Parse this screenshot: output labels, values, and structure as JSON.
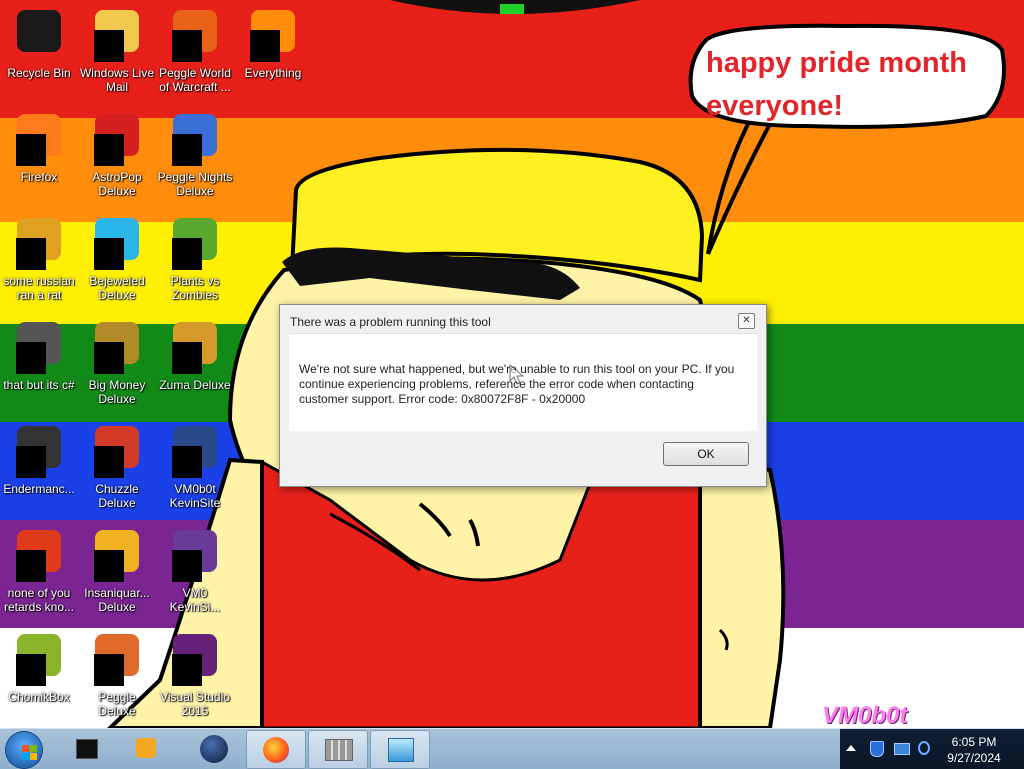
{
  "wallpaper": {
    "stripe_colors": [
      "#e8201a",
      "#ff8c0a",
      "#ffef05",
      "#118a18",
      "#1a40e8",
      "#7a2592"
    ],
    "speech_text": "happy pride month everyone!",
    "watermark": "VM0b0t"
  },
  "desktop": {
    "icons": [
      {
        "name": "icon-recycle-bin",
        "label": "Recycle Bin",
        "color": "#1a1a1a"
      },
      {
        "name": "icon-windows-live-mail",
        "label": "Windows Live Mail",
        "color": "#f2c94c"
      },
      {
        "name": "icon-peggle-world-of-warcraft",
        "label": "Peggle World of Warcraft ...",
        "color": "#e8621a"
      },
      {
        "name": "icon-everything",
        "label": "Everything",
        "color": "#ff8c0a"
      },
      {
        "name": "icon-firefox",
        "label": "Firefox",
        "color": "#ff7a1a"
      },
      {
        "name": "icon-astropop-deluxe",
        "label": "AstroPop Deluxe",
        "color": "#d62020"
      },
      {
        "name": "icon-peggle-nights-deluxe",
        "label": "Peggle Nights Deluxe",
        "color": "#3a6fd8"
      },
      {
        "name": "icon-some-russian-ran-a-rat",
        "label": "some russian ran a rat",
        "color": "#e0a020"
      },
      {
        "name": "icon-bejeweled-deluxe",
        "label": "Bejeweled Deluxe",
        "color": "#2ab5e8"
      },
      {
        "name": "icon-plants-vs-zombies",
        "label": "Plants vs Zombies",
        "color": "#5aa830"
      },
      {
        "name": "icon-that-but-its-csharp",
        "label": "that but its c#",
        "color": "#555555"
      },
      {
        "name": "icon-big-money-deluxe",
        "label": "Big Money Deluxe",
        "color": "#b38a2a"
      },
      {
        "name": "icon-zuma-deluxe",
        "label": "Zuma Deluxe",
        "color": "#d69a2a"
      },
      {
        "name": "icon-endermanch",
        "label": "Endermanc...",
        "color": "#333333"
      },
      {
        "name": "icon-chuzzle-deluxe",
        "label": "Chuzzle Deluxe",
        "color": "#d23a2a"
      },
      {
        "name": "icon-vm0b0t-kevinsite",
        "label": "VM0b0t KevinSite",
        "color": "#2a4a8a"
      },
      {
        "name": "icon-none-of-you-retards-kno",
        "label": "none of you retards kno...",
        "color": "#e03a1a"
      },
      {
        "name": "icon-insaniquarium-deluxe",
        "label": "Insaniquar... Deluxe",
        "color": "#f0b020"
      },
      {
        "name": "icon-vm0-kevinsite",
        "label": "VM0 KevinSi...",
        "color": "#6a3a9a"
      },
      {
        "name": "icon-chomikbox",
        "label": "ChomikBox",
        "color": "#8ab52a"
      },
      {
        "name": "icon-peggle-deluxe",
        "label": "Peggle Deluxe",
        "color": "#e06a2a"
      },
      {
        "name": "icon-visual-studio-2015",
        "label": "Visual Studio 2015",
        "color": "#68217a"
      }
    ]
  },
  "dialog": {
    "title": "There was a problem running this tool",
    "message": "We're not sure what happened, but we're unable to run this tool on your PC. If you continue experiencing problems, reference the error code when contacting customer support. Error code: 0x80072F8F - 0x20000",
    "ok_label": "OK",
    "close_icon": "close-icon"
  },
  "taskbar": {
    "pinned": [
      {
        "name": "taskbar-app-black-box",
        "icon": "black-box-icon",
        "active": false
      },
      {
        "name": "taskbar-app-media-player",
        "icon": "media-player-icon",
        "active": false
      },
      {
        "name": "taskbar-app-globe",
        "icon": "globe-icon",
        "active": false
      },
      {
        "name": "taskbar-app-firefox",
        "icon": "firefox-icon",
        "active": true
      },
      {
        "name": "taskbar-app-grid",
        "icon": "grid-icon",
        "active": true
      },
      {
        "name": "taskbar-app-installer",
        "icon": "installer-icon",
        "active": true
      }
    ],
    "time": "6:05 PM",
    "date": "9/27/2024"
  }
}
